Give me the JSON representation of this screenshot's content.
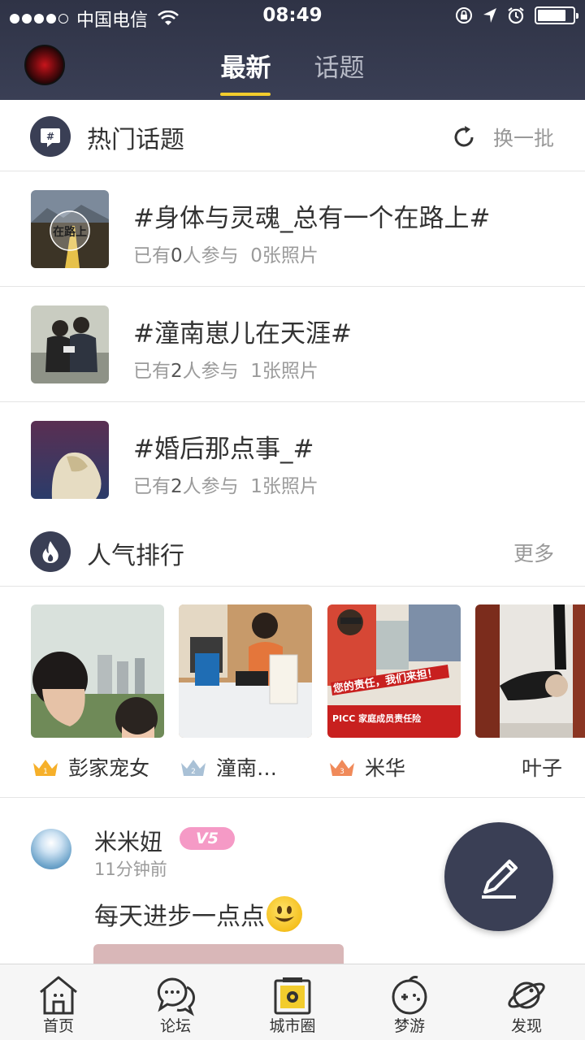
{
  "status_bar": {
    "carrier": "中国电信",
    "time": "08:49",
    "battery_level": 0.8
  },
  "header": {
    "tabs": [
      {
        "label": "最新",
        "active": true
      },
      {
        "label": "话题",
        "active": false
      }
    ]
  },
  "hot_topics": {
    "title": "热门话题",
    "action": "换一批",
    "items": [
      {
        "name": "#身体与灵魂_总有一个在路上#",
        "prefix": "已有",
        "participants": "0",
        "mid": "人参与",
        "photos": "0张照片",
        "thumb_text": "在路上"
      },
      {
        "name": "#潼南崽儿在天涯#",
        "prefix": "已有",
        "participants": "2",
        "mid": "人参与",
        "photos": "1张照片"
      },
      {
        "name": "#婚后那点事_#",
        "prefix": "已有",
        "participants": "2",
        "mid": "人参与",
        "photos": "1张照片"
      }
    ]
  },
  "popular": {
    "title": "人气排行",
    "action": "更多",
    "items": [
      {
        "name": "彭家宠女",
        "rank": "1"
      },
      {
        "name": "潼南…",
        "rank": "2"
      },
      {
        "name": "米华",
        "rank": "3"
      },
      {
        "name": "叶子",
        "rank": ""
      }
    ],
    "ad_text_1": "您的责任，我们来担！",
    "ad_text_2": "PICC 家庭成员责任险"
  },
  "post": {
    "author": "米米妞",
    "vip": "V5",
    "time": "11分钟前",
    "text": "每天进步一点点"
  },
  "bottom_nav": [
    {
      "label": "首页"
    },
    {
      "label": "论坛"
    },
    {
      "label": "城市圈"
    },
    {
      "label": "梦游"
    },
    {
      "label": "发现"
    }
  ],
  "colors": {
    "header_bg": "#3a3f55",
    "tab_indicator": "#f2cc2d",
    "vip_badge": "#f59ac6"
  }
}
